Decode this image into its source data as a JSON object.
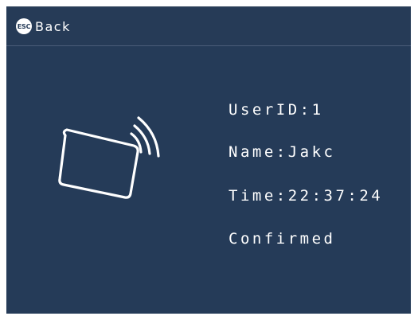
{
  "topbar": {
    "esc_icon": "ESC",
    "back_label": "Back"
  },
  "icons": {
    "card": "nfc-card-icon"
  },
  "info": {
    "user_id": "UserID:1",
    "name": "Name:Jakc",
    "time": "Time:22:37:24",
    "status": "Confirmed"
  },
  "colors": {
    "background": "#253b58",
    "text": "#ffffff"
  }
}
